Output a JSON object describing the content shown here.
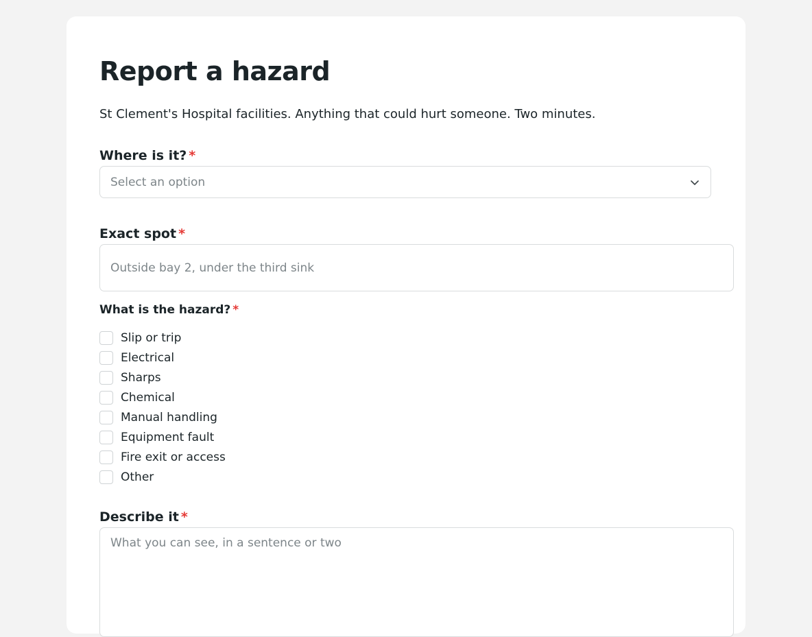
{
  "form": {
    "title": "Report a hazard",
    "subtitle": "St Clement's Hospital facilities. Anything that could hurt someone. Two minutes.",
    "required_marker": "*",
    "location": {
      "label": "Where is it?",
      "placeholder": "Select an option",
      "icon": "chevron-down-icon"
    },
    "spot": {
      "label": "Exact spot",
      "placeholder": "Outside bay 2, under the third sink"
    },
    "hazard": {
      "label": "What is the hazard?",
      "options": [
        {
          "label": "Slip or trip",
          "checked": false
        },
        {
          "label": "Electrical",
          "checked": false
        },
        {
          "label": "Sharps",
          "checked": false
        },
        {
          "label": "Chemical",
          "checked": false
        },
        {
          "label": "Manual handling",
          "checked": false
        },
        {
          "label": "Equipment fault",
          "checked": false
        },
        {
          "label": "Fire exit or access",
          "checked": false
        },
        {
          "label": "Other",
          "checked": false
        }
      ]
    },
    "description": {
      "label": "Describe it",
      "placeholder": "What you can see, in a sentence or two"
    }
  },
  "colors": {
    "background": "#f3f3f3",
    "card": "#ffffff",
    "text": "#1b2428",
    "required": "#e53935",
    "placeholder": "#7d8589",
    "border": "#d9dcdd"
  }
}
